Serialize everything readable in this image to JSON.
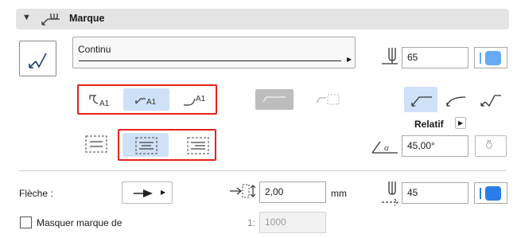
{
  "header": {
    "title": "Marque",
    "expand_icon": "triangle-down-icon",
    "icon": "label-marker-icon"
  },
  "line_type": {
    "value": "Continu"
  },
  "size_field": {
    "value": "65"
  },
  "relatif": {
    "label": "Relatif"
  },
  "angle_field": {
    "value": "45,00°"
  },
  "fleche": {
    "label": "Flèche :"
  },
  "spacing_field": {
    "value": "2,00",
    "unit": "mm"
  },
  "right_size_field": {
    "value": "45"
  },
  "masquer": {
    "label": "Masquer marque de",
    "checked": false
  },
  "scale": {
    "prefix": "1:",
    "value": "1000"
  },
  "colors": {
    "highlight": "#e8221b",
    "selected": "#cfe1f7",
    "toggle": "#2b7de9"
  }
}
